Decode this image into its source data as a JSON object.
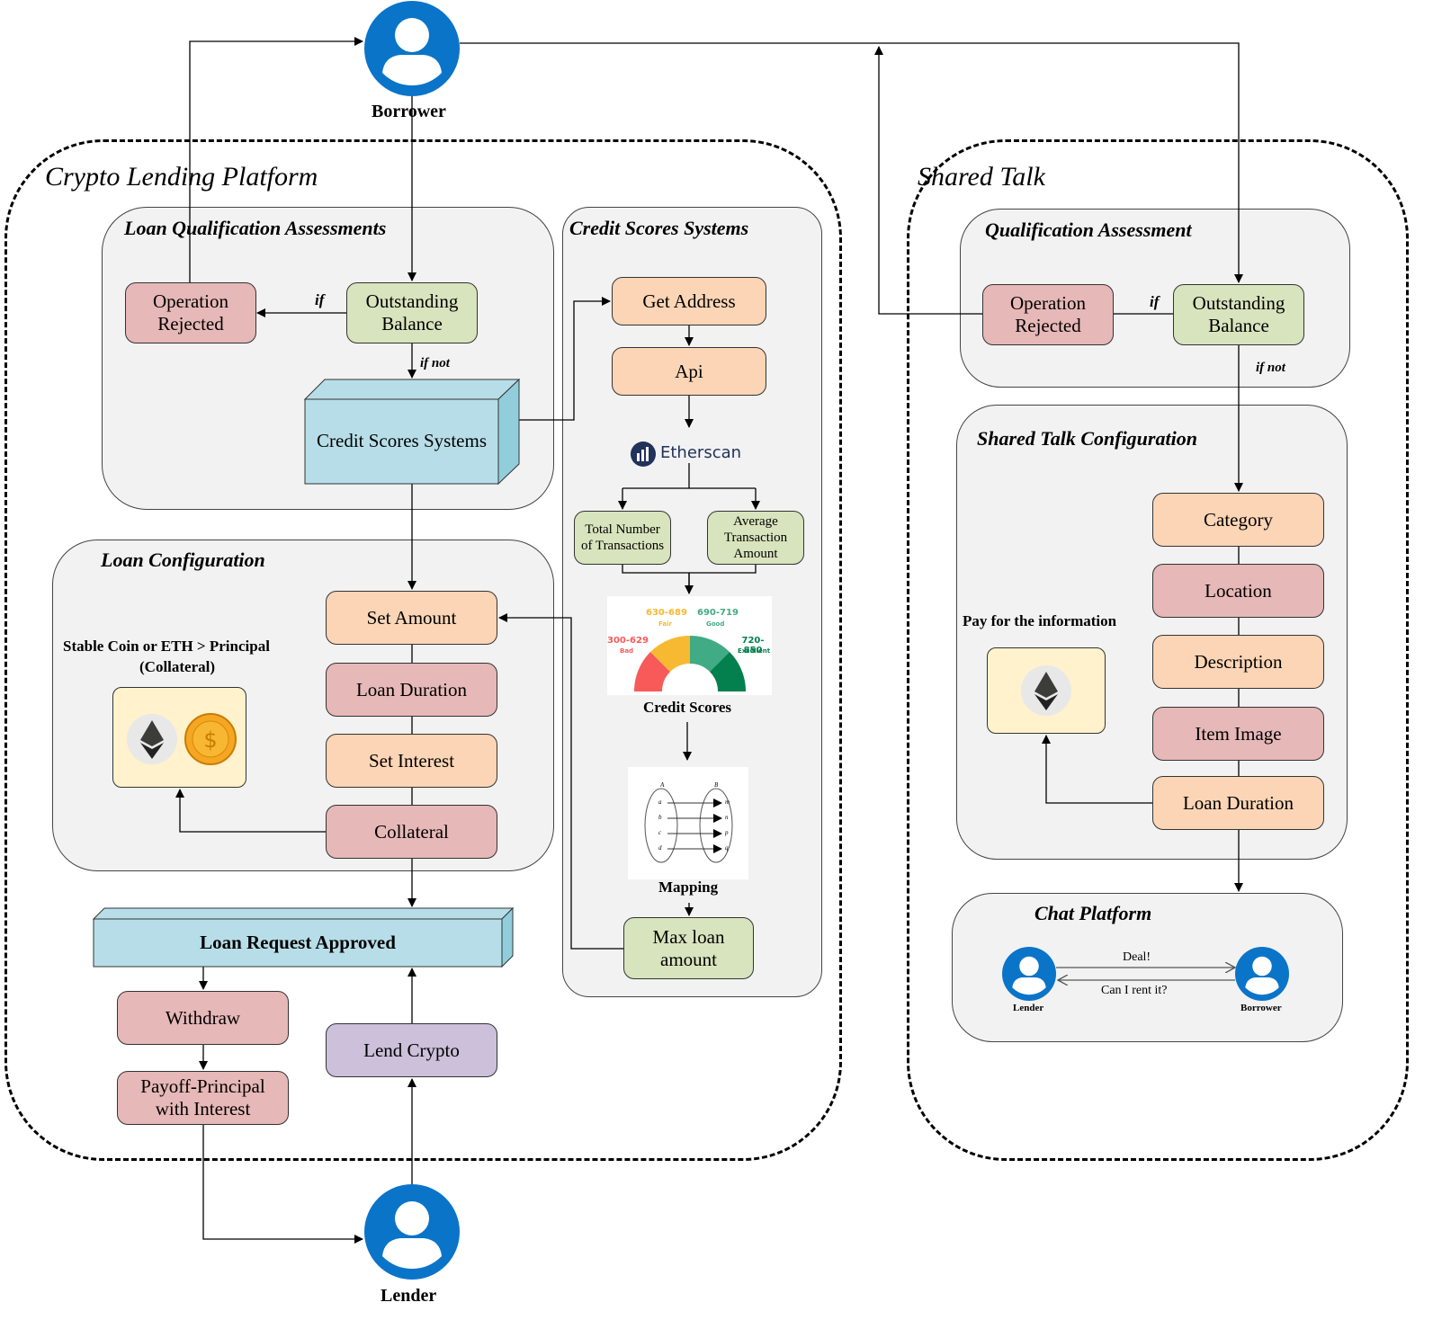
{
  "actors": {
    "borrower": "Borrower",
    "lender": "Lender"
  },
  "platform": {
    "title": "Crypto Lending Platform",
    "qualification": {
      "title": "Loan Qualification Assessments",
      "operation_rejected": "Operation Rejected",
      "outstanding_balance": "Outstanding Balance",
      "if_label": "if",
      "if_not_label": "if not",
      "credit_scores_systems": "Credit Scores Systems"
    },
    "credit_scores": {
      "title": "Credit Scores Systems",
      "get_address": "Get Address",
      "api": "Api",
      "etherscan": "Etherscan",
      "total_transactions": "Total Number of Transactions",
      "average_amount": "Average Transaction Amount",
      "gauge": {
        "ranges": [
          {
            "range": "300-629",
            "label": "Bad",
            "color": "#f85a5a"
          },
          {
            "range": "630-689",
            "label": "Fair",
            "color": "#f8b932"
          },
          {
            "range": "690-719",
            "label": "Good",
            "color": "#40ab84"
          },
          {
            "range": "720-850",
            "label": "Excellent",
            "color": "#047f4e"
          }
        ]
      },
      "credit_scores_label": "Credit Scores",
      "mapping": {
        "set_a": "A",
        "set_b": "B",
        "a_items": [
          "a",
          "b",
          "c",
          "d"
        ],
        "b_items": [
          "m",
          "n",
          "p",
          "q"
        ]
      },
      "mapping_label": "Mapping",
      "max_loan": "Max loan amount"
    },
    "loan_config": {
      "title": "Loan Configuration",
      "collateral_note_line1": "Stable Coin or ETH > Principal",
      "collateral_note_line2": "(Collateral)",
      "set_amount": "Set Amount",
      "loan_duration": "Loan Duration",
      "set_interest": "Set Interest",
      "collateral": "Collateral"
    },
    "loan_request_approved": "Loan Request Approved",
    "withdraw": "Withdraw",
    "payoff": "Payoff-Principal with Interest",
    "lend_crypto": "Lend Crypto"
  },
  "shared_talk": {
    "title": "Shared Talk",
    "qualification": {
      "title": "Qualification Assessment",
      "operation_rejected": "Operation Rejected",
      "outstanding_balance": "Outstanding Balance",
      "if_label": "if",
      "if_not_label": "if not"
    },
    "config": {
      "title": "Shared Talk Configuration",
      "pay_label": "Pay for the information",
      "category": "Category",
      "location": "Location",
      "description": "Description",
      "item_image": "Item Image",
      "loan_duration": "Loan Duration"
    },
    "chat": {
      "title": "Chat Platform",
      "deal": "Deal!",
      "question": "Can I rent it?",
      "lender": "Lender",
      "borrower": "Borrower"
    }
  },
  "colors": {
    "actor_blue": "#0a74c9",
    "pink": "#e6b8b7",
    "green": "#d7e4bd",
    "peach": "#fbd5b5",
    "cyan": "#b7dee8",
    "purple": "#ccc0da",
    "coin_bg": "#fff2cc"
  }
}
